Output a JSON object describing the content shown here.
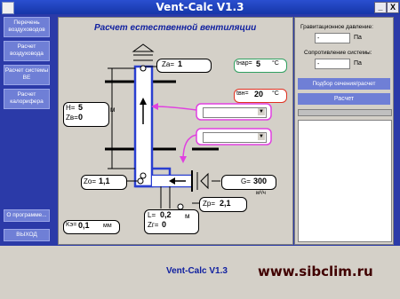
{
  "window": {
    "title": "Vent-Calc V1.3",
    "min_label": "_",
    "close_label": "X"
  },
  "sidebar": {
    "items": [
      {
        "label": "Перечень воздуховодов"
      },
      {
        "label": "Расчет воздуховода"
      },
      {
        "label": "Расчет системы ВЕ"
      },
      {
        "label": "Расчет калорифера"
      }
    ],
    "about_label": "О программе...",
    "exit_label": "ВЫХОД"
  },
  "diagram": {
    "title": "Расчет естественной вентиляции",
    "za_label": "Za=",
    "za_value": "1",
    "tnar_label": "tнар=",
    "tnar_value": "5",
    "tnar_unit": "°C",
    "tvn_label": "tвн=",
    "tvn_value": "20",
    "tvn_unit": "°C",
    "h_label": "H=",
    "h_value": "5",
    "h_unit": "м",
    "zv_label": "Zв=",
    "zv_value": "0",
    "zo_label": "Zo=",
    "zo_value": "1,1",
    "g_label": "G=",
    "g_value": "300",
    "g_unit": "м³/ч",
    "zp_label": "Zp=",
    "zp_value": "2,1",
    "l_label": "L=",
    "l_value": "0,2",
    "l_unit": "м",
    "zg_label": "Zг=",
    "zg_value": "0",
    "ke_label": "Kэ=",
    "ke_value": "0,1",
    "ke_unit": "мм"
  },
  "panel": {
    "grav_label": "Гравитационное давление:",
    "grav_value": "-",
    "grav_unit": "Па",
    "resist_label": "Сопротивление системы:",
    "resist_value": "-",
    "resist_unit": "Па",
    "select_button": "Подбор сечения/расчет",
    "calc_button": "Расчет"
  },
  "footer": {
    "app_name": "Vent-Calc V1.3",
    "url": "www.sibclim.ru"
  },
  "colors": {
    "accent": "#2b3aa8",
    "duct": "#2a3fd0",
    "magenta": "#e040e0",
    "red": "#e03020"
  }
}
